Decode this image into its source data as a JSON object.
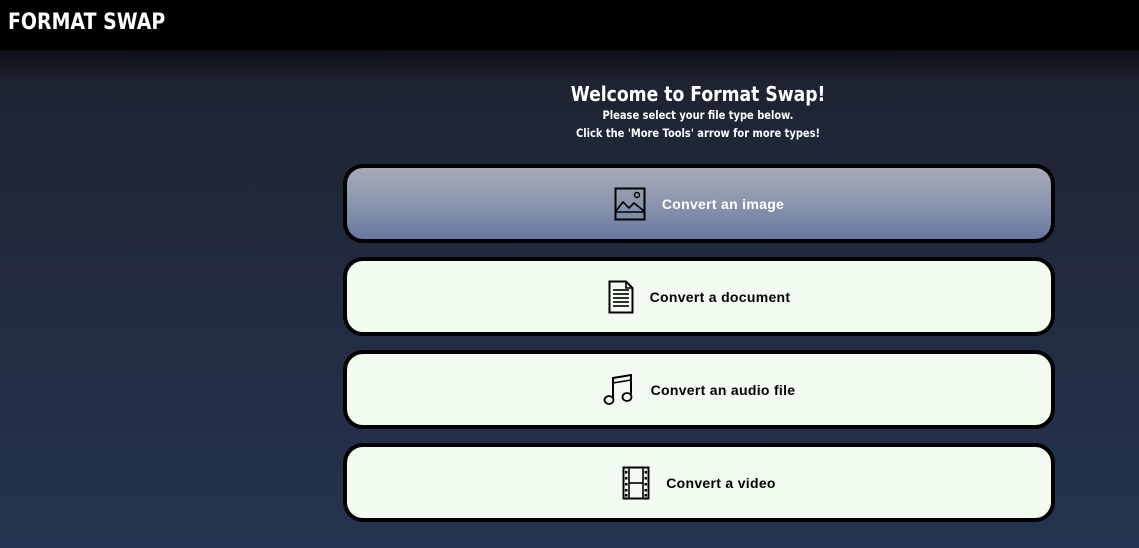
{
  "brand": {
    "title": "FORMAT SWAP"
  },
  "intro": {
    "title": "Welcome to Format Swap!",
    "line1": "Please select your file type below.",
    "line2": "Click the 'More Tools' arrow for more types!"
  },
  "options": [
    {
      "label": "Convert an image",
      "icon": "image-icon",
      "selected": true
    },
    {
      "label": "Convert a document",
      "icon": "document-icon",
      "selected": false
    },
    {
      "label": "Convert an audio file",
      "icon": "music-note-icon",
      "selected": false
    },
    {
      "label": "Convert a video",
      "icon": "film-strip-icon",
      "selected": false
    }
  ]
}
